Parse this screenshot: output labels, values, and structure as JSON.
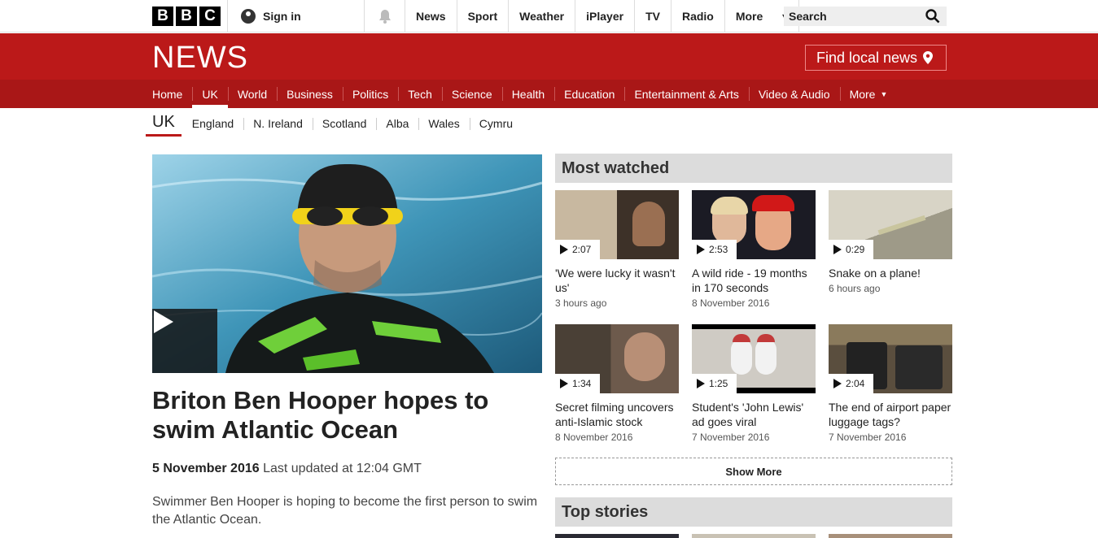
{
  "topbar": {
    "logo_letters": [
      "B",
      "B",
      "C"
    ],
    "signin_label": "Sign in",
    "nav": [
      "News",
      "Sport",
      "Weather",
      "iPlayer",
      "TV",
      "Radio",
      "More"
    ],
    "search_placeholder": "Search"
  },
  "banner": {
    "title": "NEWS",
    "local_news_label": "Find local news",
    "brand_color": "#bb1919"
  },
  "section_nav": {
    "items": [
      "Home",
      "UK",
      "World",
      "Business",
      "Politics",
      "Tech",
      "Science",
      "Health",
      "Education",
      "Entertainment & Arts",
      "Video & Audio",
      "More"
    ],
    "active": "UK"
  },
  "sub_nav": {
    "current": "UK",
    "items": [
      "England",
      "N. Ireland",
      "Scotland",
      "Alba",
      "Wales",
      "Cymru"
    ]
  },
  "article": {
    "headline": "Briton Ben Hooper hopes to swim Atlantic Ocean",
    "date": "5 November 2016",
    "updated": "Last updated at 12:04 GMT",
    "summary": "Swimmer Ben Hooper is hoping to become the first person to swim the Atlantic Ocean."
  },
  "most_watched": {
    "heading": "Most watched",
    "items": [
      {
        "duration": "2:07",
        "title": "'We were lucky it wasn't us'",
        "time": "3 hours ago"
      },
      {
        "duration": "2:53",
        "title": "A wild ride - 19 months in 170 seconds",
        "time": "8 November 2016"
      },
      {
        "duration": "0:29",
        "title": "Snake on a plane!",
        "time": "6 hours ago"
      },
      {
        "duration": "1:34",
        "title": "Secret filming uncovers anti-Islamic stock",
        "time": "8 November 2016"
      },
      {
        "duration": "1:25",
        "title": "Student's 'John Lewis' ad goes viral",
        "time": "7 November 2016"
      },
      {
        "duration": "2:04",
        "title": "The end of airport paper luggage tags?",
        "time": "7 November 2016"
      }
    ],
    "show_more_label": "Show More"
  },
  "top_stories": {
    "heading": "Top stories"
  }
}
